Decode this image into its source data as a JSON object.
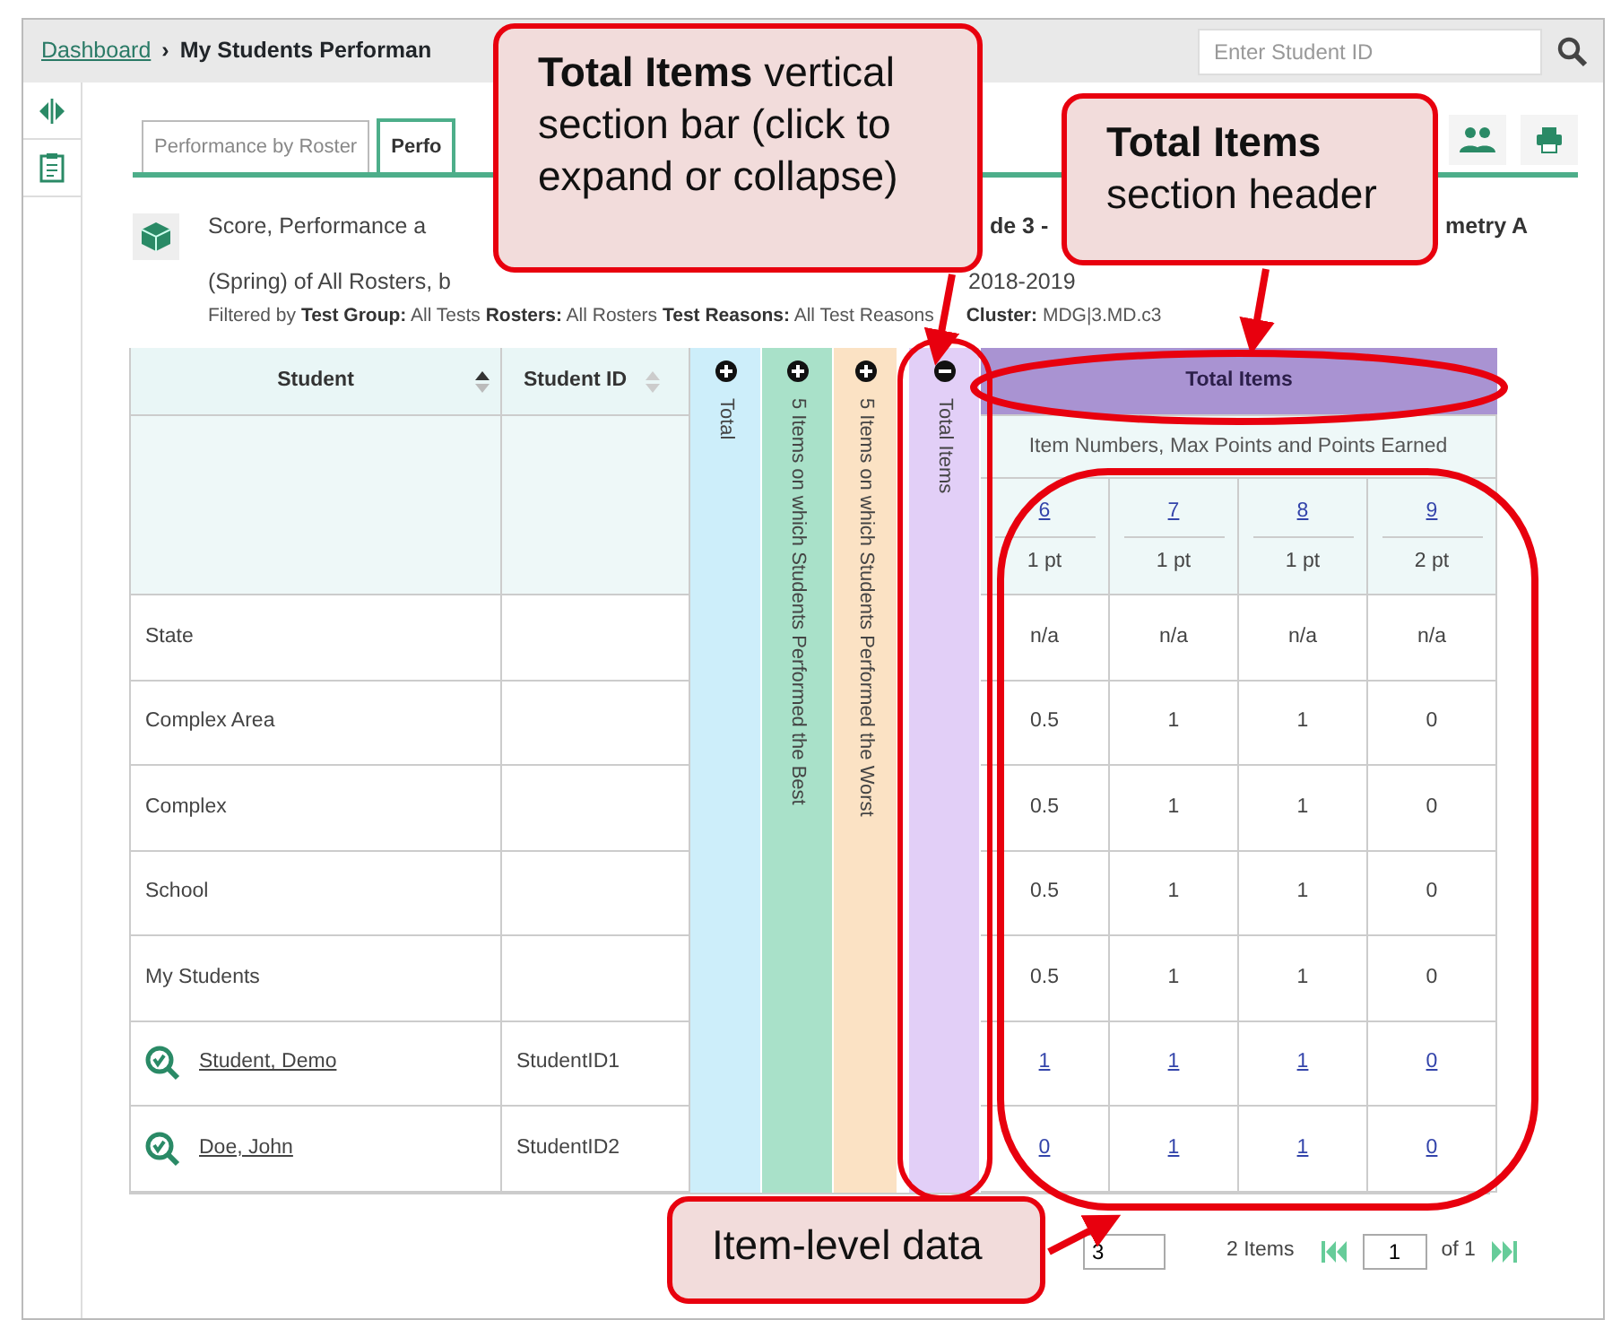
{
  "breadcrumb": {
    "link": "Dashboard",
    "separator": "›",
    "current": "My Students Performan"
  },
  "search": {
    "placeholder": "Enter Student ID"
  },
  "tabs": [
    {
      "label": "Performance by Roster",
      "selected": false
    },
    {
      "label": "Perfo",
      "selected": true
    }
  ],
  "report": {
    "title_parts": [
      "Score, Performance a",
      "de 3 -",
      "metry A"
    ],
    "subtitle_parts": [
      "(Spring) of All Rosters, b",
      "2018-2019"
    ],
    "filters": [
      "Filtered by **Test Group:** All Tests  **Rosters:** All Rosters  **Test Reasons:** All Test Reasons",
      "**Cluster:** MDG|3.MD.c3"
    ]
  },
  "table": {
    "columns": [
      {
        "label": "Student",
        "sorted": true
      },
      {
        "label": "Student ID",
        "sorted": false
      }
    ],
    "section_bars": [
      {
        "label": "Total",
        "color": "#cdeefa",
        "expanded": false
      },
      {
        "label": "5 Items on which Students Performed the Best",
        "color": "#a9e1c9",
        "expanded": false
      },
      {
        "label": "5 Items on which Students Performed the Worst",
        "color": "#fbe2c4",
        "expanded": false
      },
      {
        "label": "Total Items",
        "color": "#e2cff7",
        "expanded": true
      }
    ],
    "section_header": "Total Items",
    "section_subheader": "Item Numbers, Max Points and Points Earned",
    "items": [
      {
        "number": "6",
        "points": "1 pt"
      },
      {
        "number": "7",
        "points": "1 pt"
      },
      {
        "number": "8",
        "points": "1 pt"
      },
      {
        "number": "9",
        "points": "2 pt"
      }
    ],
    "rows": [
      {
        "kind": "group",
        "name": "State",
        "values": [
          "n/a",
          "n/a",
          "n/a",
          "n/a"
        ]
      },
      {
        "kind": "group",
        "name": "Complex Area",
        "values": [
          "0.5",
          "1",
          "1",
          "0"
        ]
      },
      {
        "kind": "group",
        "name": "Complex",
        "values": [
          "0.5",
          "1",
          "1",
          "0"
        ]
      },
      {
        "kind": "group",
        "name": "School",
        "values": [
          "0.5",
          "1",
          "1",
          "0"
        ]
      },
      {
        "kind": "group",
        "name": "My Students",
        "values": [
          "0.5",
          "1",
          "1",
          "0"
        ]
      },
      {
        "kind": "student",
        "name": "Student, Demo",
        "id": "StudentID1",
        "values": [
          "1",
          "1",
          "1",
          "0"
        ]
      },
      {
        "kind": "student",
        "name": "Doe, John",
        "id": "StudentID2",
        "values": [
          "0",
          "1",
          "1",
          "0"
        ]
      }
    ]
  },
  "pager": {
    "page_size": "3",
    "count": "2 Items",
    "page": "1",
    "of": "of 1"
  },
  "callouts": [
    {
      "text": "**Total Items** vertical section bar (click to expand or collapse)"
    },
    {
      "text": "**Total Items** section header"
    },
    {
      "text": "Item-level data"
    }
  ]
}
